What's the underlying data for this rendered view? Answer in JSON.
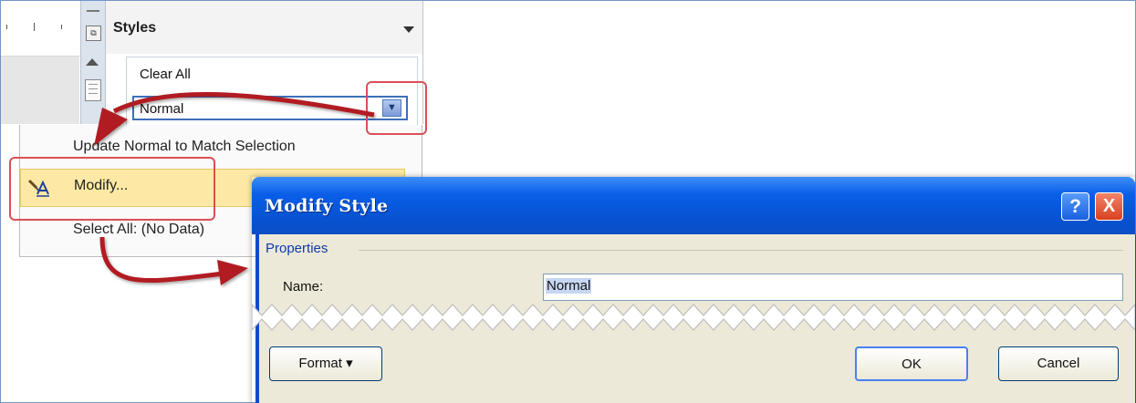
{
  "styles_pane": {
    "title": "Styles",
    "clear_all": "Clear All",
    "normal_style": "Normal"
  },
  "context_menu": {
    "update_item": "Update Normal to Match Selection",
    "modify_item": "Modify...",
    "select_item": "Select All: (No Data)"
  },
  "dialog": {
    "title": "Modify Style",
    "help_label": "?",
    "close_label": "X",
    "section": "Properties",
    "name_label": "Name:",
    "name_value": "Normal",
    "format_button": "Format ▾",
    "ok_button": "OK",
    "cancel_button": "Cancel"
  },
  "colors": {
    "callout": "#d95057",
    "arrow": "#b11b20",
    "titlebar": "#0a5ee8",
    "menu_highlight": "#fde9a5"
  },
  "icons": [
    "dropdown-arrow-icon",
    "scroll-up-icon",
    "modify-style-icon",
    "help-icon",
    "close-icon"
  ]
}
